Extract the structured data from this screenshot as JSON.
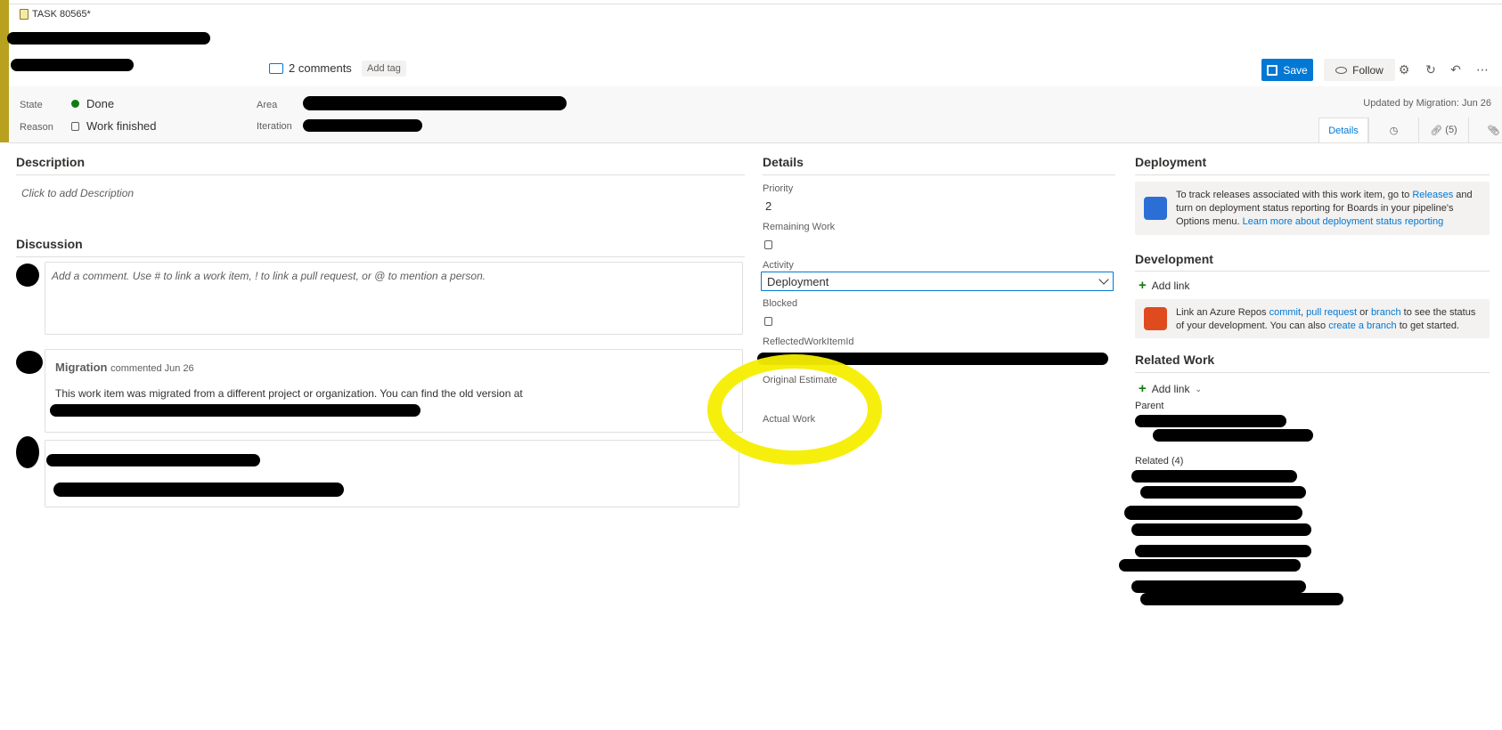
{
  "header": {
    "work_item_label": "TASK 80565*",
    "comments_label": "2 comments",
    "add_tag_label": "Add tag",
    "save_label": "Save",
    "follow_label": "Follow",
    "updated_text": "Updated by Migration: Jun 26"
  },
  "state": {
    "state_label": "State",
    "state_value": "Done",
    "reason_label": "Reason",
    "reason_value": "Work finished",
    "area_label": "Area",
    "iteration_label": "Iteration"
  },
  "tabs": [
    {
      "label": "Details"
    },
    {
      "label": ""
    },
    {
      "label": "(5)"
    },
    {
      "label": ""
    }
  ],
  "description": {
    "title": "Description",
    "placeholder": "Click to add Description"
  },
  "discussion": {
    "title": "Discussion",
    "comment_placeholder": "Add a comment. Use # to link a work item, ! to link a pull request, or @ to mention a person.",
    "comments": [
      {
        "author": "Migration",
        "meta": "commented Jun 26",
        "text": "This work item was migrated from a different project or organization. You can find the old version at"
      }
    ]
  },
  "details": {
    "title": "Details",
    "priority_label": "Priority",
    "priority_value": "2",
    "remaining_work_label": "Remaining Work",
    "activity_label": "Activity",
    "activity_value": "Deployment",
    "blocked_label": "Blocked",
    "reflected_label": "ReflectedWorkItemId",
    "original_estimate_label": "Original Estimate",
    "actual_work_label": "Actual Work"
  },
  "deployment": {
    "title": "Deployment",
    "text_1": "To track releases associated with this work item, go to ",
    "link_releases": "Releases",
    "text_2": " and turn on deployment status reporting for Boards in your pipeline's Options menu. ",
    "link_learn": "Learn more about deployment status reporting"
  },
  "development": {
    "title": "Development",
    "add_link_label": "Add link",
    "text_1": "Link an Azure Repos ",
    "link_commit": "commit",
    "sep_1": ", ",
    "link_pr": "pull request",
    "sep_2": " or ",
    "link_branch": "branch",
    "text_2": " to see the status of your development. You can also ",
    "link_create_branch": "create a branch",
    "text_3": " to get started."
  },
  "related_work": {
    "title": "Related Work",
    "add_link_label": "Add link",
    "parent_label": "Parent",
    "related_label": "Related (4)"
  },
  "colors": {
    "accent": "#0078d4",
    "task_bar": "#b7a11f",
    "done_green": "#107c10",
    "highlight": "#f5ee00"
  }
}
